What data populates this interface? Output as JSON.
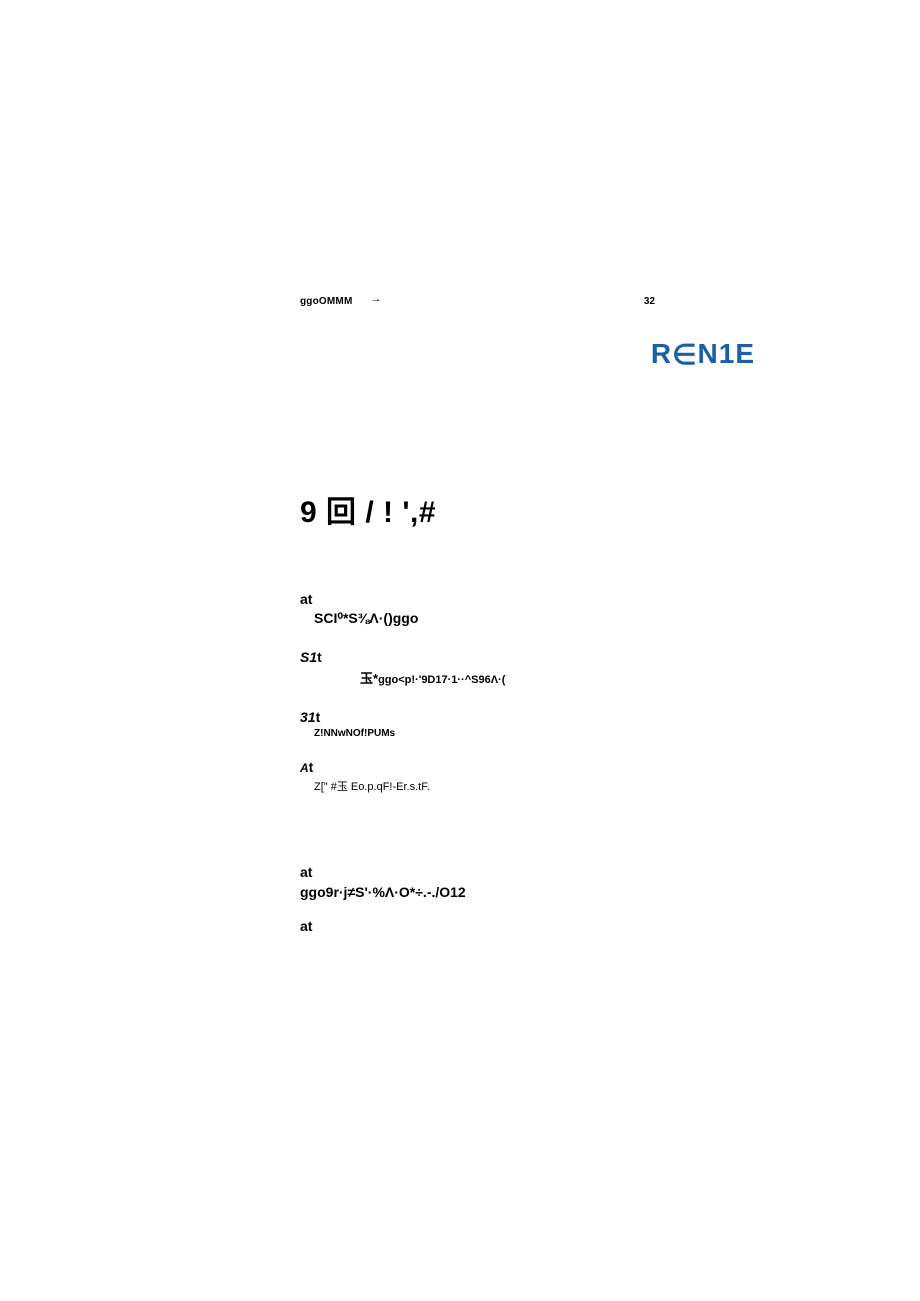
{
  "header": {
    "left": "ggoOMMM",
    "arrow": "→",
    "right": "32"
  },
  "logo": {
    "r": "R",
    "elem": "∈",
    "rest": "N1E"
  },
  "title": "9 回 / ! ',#",
  "sections": {
    "s1": {
      "label": "at",
      "content": "SCI⁰*S⅜Λ·()ggo"
    },
    "s2": {
      "label_prefix": "S1",
      "label_suffix": "t",
      "content_prefix": "玉*",
      "content_mid": "ggo",
      "content_suffix": "<p!·'9D17·1··^S96Λ·("
    },
    "s3": {
      "label_prefix": "31",
      "label_suffix": "t",
      "content": "Z!NNwNOf!PUMs"
    },
    "s4": {
      "label_prefix": "A",
      "label_suffix": "t",
      "content": "Z[\" #玉 Eo.p.qF!-Er.s.tF."
    },
    "s5": {
      "label": "at",
      "content": "ggo9r·j≠S'·%Λ·O*÷.-./O12"
    },
    "s6": {
      "label": "at"
    }
  }
}
